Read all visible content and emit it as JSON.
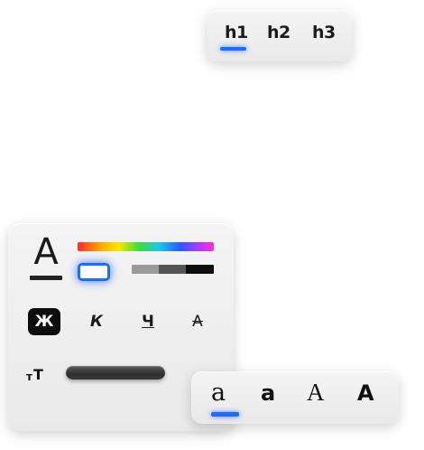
{
  "heading_picker": {
    "options": [
      "h1",
      "h2",
      "h3"
    ],
    "selected": "h1",
    "accent_color": "#1e6bff"
  },
  "format_panel": {
    "font_color_icon": "font-color-icon",
    "font_color_letter": "A",
    "color_palette": "rainbow-spectrum",
    "selected_color": "#ffffff",
    "grayscale_colors": [
      "#9a9a9a",
      "#555555",
      "#0d0d0d"
    ],
    "styles": [
      {
        "label": "Ж",
        "name": "bold",
        "active": true
      },
      {
        "label": "К",
        "name": "italic",
        "active": false
      },
      {
        "label": "Ч",
        "name": "underline",
        "active": false
      },
      {
        "label": "А",
        "name": "strikethrough",
        "active": false
      }
    ],
    "size_icon": "text-size-icon",
    "size_icon_small": "т",
    "size_icon_big": "Т"
  },
  "font_picker": {
    "options": [
      "a",
      "a",
      "A",
      "A"
    ],
    "selected_index": 0
  }
}
